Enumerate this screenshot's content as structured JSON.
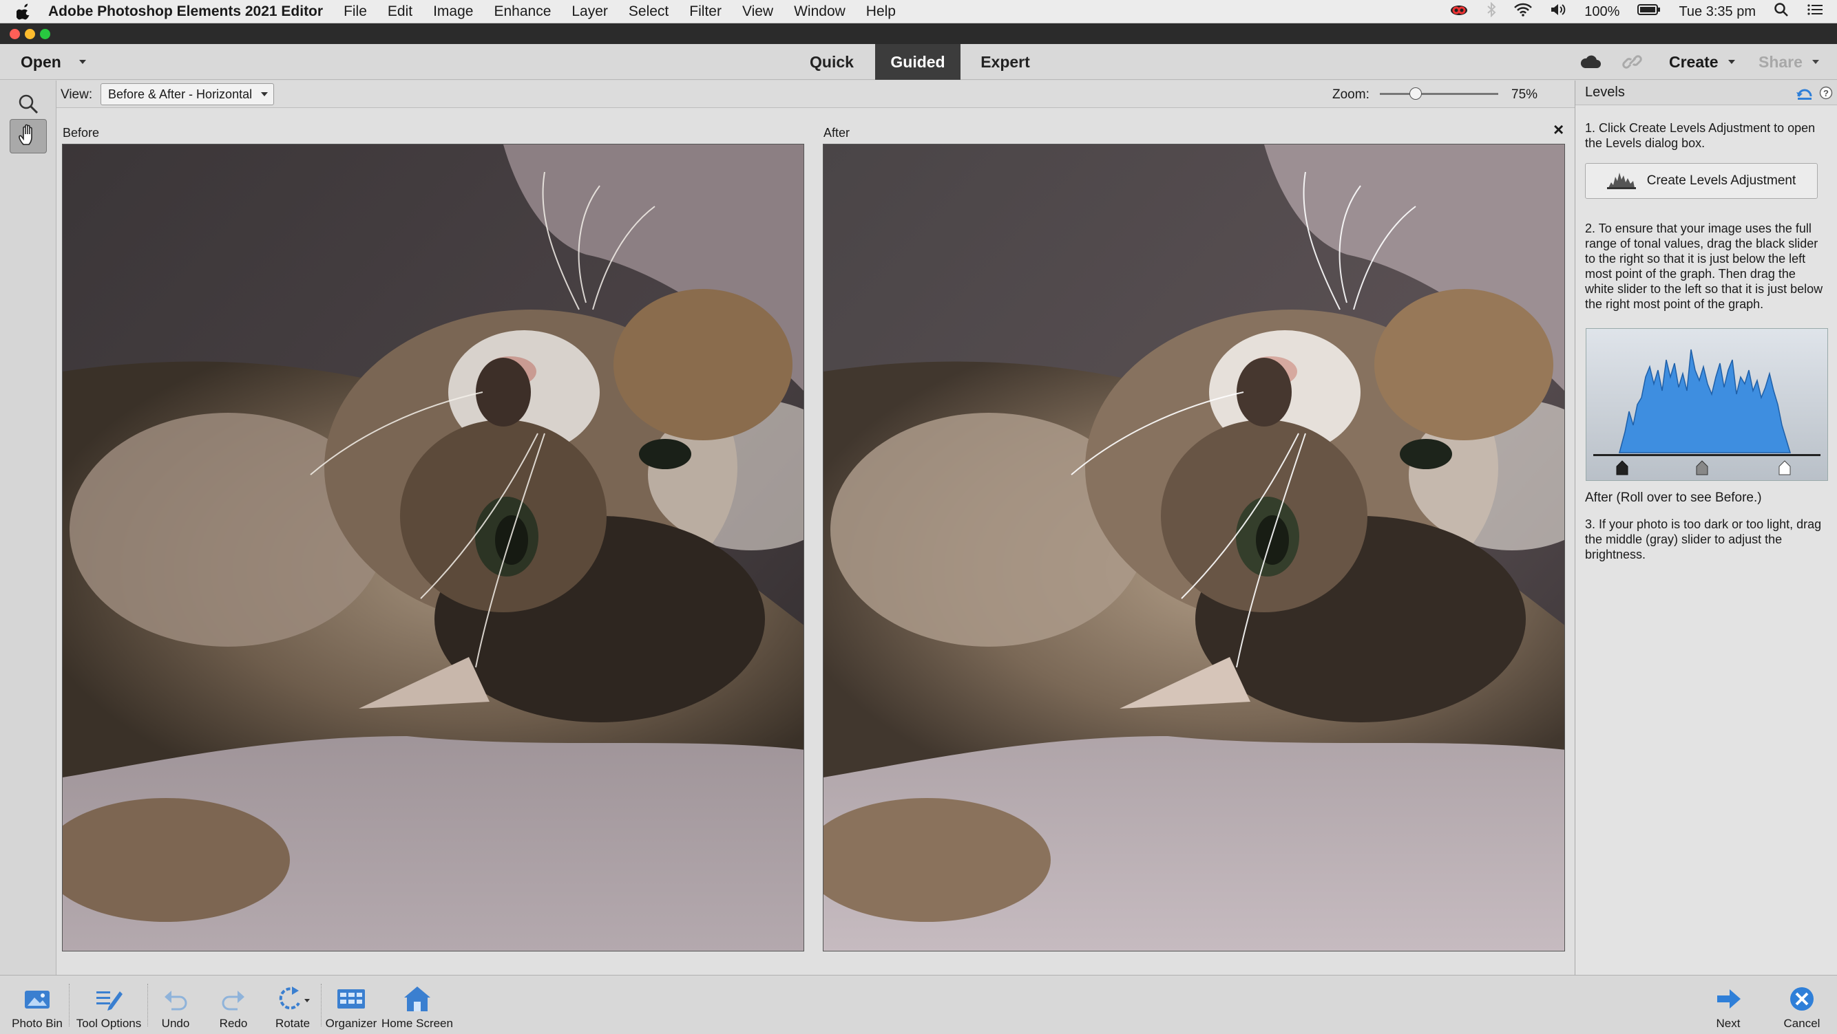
{
  "menubar": {
    "app_name": "Adobe Photoshop Elements 2021 Editor",
    "menus": [
      "File",
      "Edit",
      "Image",
      "Enhance",
      "Layer",
      "Select",
      "Filter",
      "View",
      "Window",
      "Help"
    ],
    "battery": "100%",
    "clock": "Tue 3:35 pm"
  },
  "modebar": {
    "open_label": "Open",
    "tabs": [
      {
        "label": "Quick",
        "active": false
      },
      {
        "label": "Guided",
        "active": true
      },
      {
        "label": "Expert",
        "active": false
      }
    ],
    "create_label": "Create",
    "share_label": "Share"
  },
  "options": {
    "view_label": "View:",
    "view_value": "Before & After - Horizontal",
    "zoom_label": "Zoom:",
    "zoom_value": "75%",
    "zoom_level": 0.3
  },
  "canvas": {
    "before_label": "Before",
    "after_label": "After",
    "close_glyph": "×"
  },
  "panel": {
    "title": "Levels",
    "step1": "1. Click Create Levels Adjustment to open the Levels dialog box.",
    "create_button": "Create Levels Adjustment",
    "step2": "2. To ensure that your image uses the full range of tonal values, drag the black slider to the right so that it is just below the left most point of the graph. Then drag the white slider to the left so that it is just below the right most point of the graph.",
    "after_note": "After (Roll over to see Before.)",
    "step3": "3. If your photo is too dark or too light, drag the middle (gray) slider to adjust the brightness."
  },
  "bottombar": {
    "photo_bin": "Photo Bin",
    "tool_options": "Tool Options",
    "undo": "Undo",
    "redo": "Redo",
    "rotate": "Rotate",
    "organizer": "Organizer",
    "home_screen": "Home Screen",
    "next": "Next",
    "cancel": "Cancel"
  },
  "colors": {
    "accent_blue": "#2f7fd8",
    "active_tab": "#3c3c3c",
    "histogram_fill": "#3e8ee0"
  }
}
